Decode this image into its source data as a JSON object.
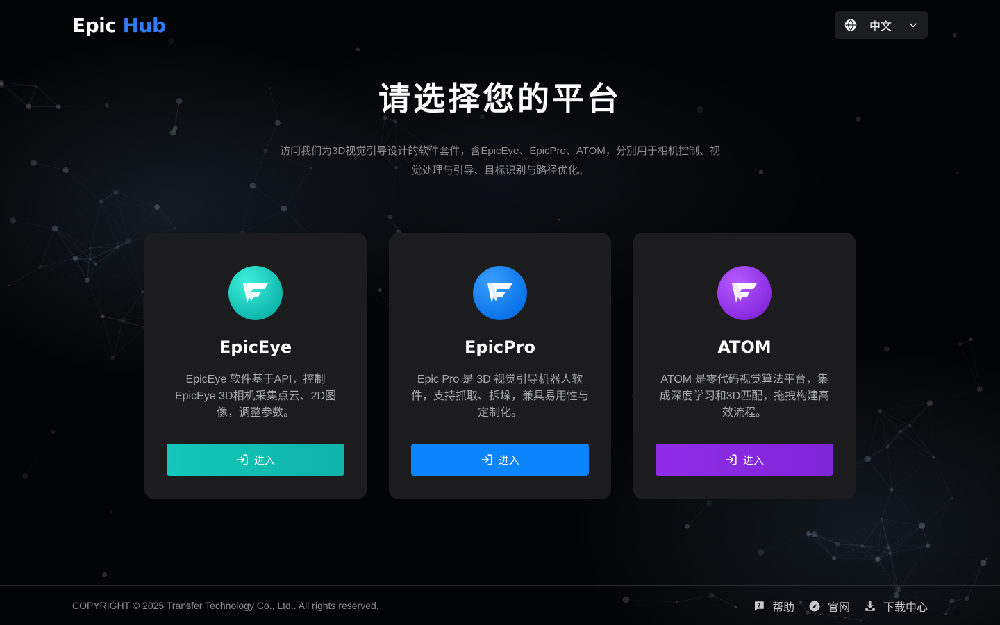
{
  "header": {
    "logo_primary": "Epic",
    "logo_accent": "Hub",
    "language": "中文"
  },
  "hero": {
    "title": "请选择您的平台",
    "description": "访问我们为3D视觉引导设计的软件套件，含EpicEye、EpicPro、ATOM，分别用于相机控制、视觉处理与引导、目标识别与路径优化。"
  },
  "cards": [
    {
      "name": "EpicEye",
      "description": "EpicEye 软件基于API，控制EpicEye 3D相机采集点云、2D图像，调整参数。",
      "button_label": "进入",
      "color": "#12c7bb",
      "icon": "epiceye-logo-icon"
    },
    {
      "name": "EpicPro",
      "description": "Epic Pro 是 3D 视觉引导机器人软件，支持抓取、拆垛，兼具易用性与定制化。",
      "button_label": "进入",
      "color": "#0a84ff",
      "icon": "epicpro-logo-icon"
    },
    {
      "name": "ATOM",
      "description": "ATOM 是零代码视觉算法平台，集成深度学习和3D匹配，拖拽构建高效流程。",
      "button_label": "进入",
      "color": "#8a2be2",
      "icon": "atom-logo-icon"
    }
  ],
  "footer": {
    "copyright": "COPYRIGHT © 2025 Transfer Technology Co., Ltd.. All rights reserved.",
    "links": [
      {
        "label": "帮助",
        "icon": "help-chat-icon"
      },
      {
        "label": "官网",
        "icon": "compass-icon"
      },
      {
        "label": "下载中心",
        "icon": "download-icon"
      }
    ]
  },
  "colors": {
    "brand_accent": "#2f7df6",
    "card_background": "#1c1c1e",
    "page_background": "#030405"
  }
}
